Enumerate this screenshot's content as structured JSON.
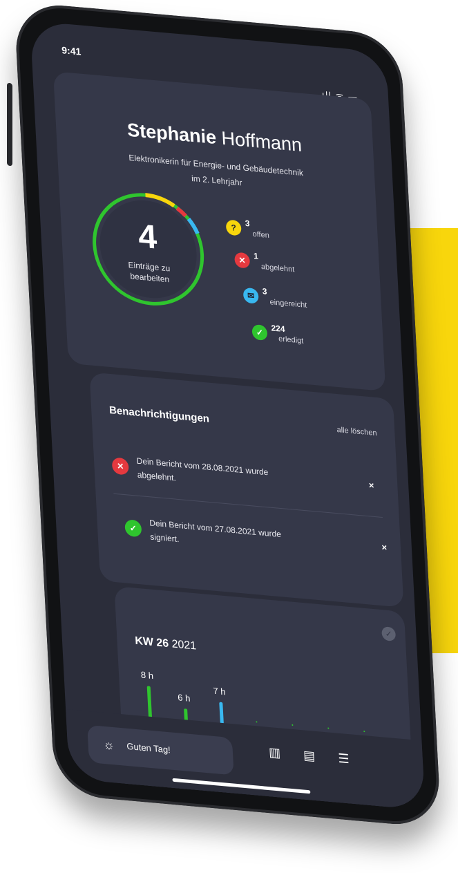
{
  "status_bar": {
    "time": "9:41",
    "icons": "ıll ᯤ ▬"
  },
  "profile": {
    "first_name": "Stephanie",
    "last_name": "Hoffmann",
    "role_line1": "Elektronikerin für Energie- und Gebäudetechnik",
    "role_line2": "im 2. Lehrjahr",
    "open_entries_count": "4",
    "open_entries_label_line1": "Einträge zu",
    "open_entries_label_line2": "bearbeiten",
    "stats": [
      {
        "icon": "?",
        "count": "3",
        "label": "offen",
        "color": "#f8d60c"
      },
      {
        "icon": "✕",
        "count": "1",
        "label": "abgelehnt",
        "color": "#e5393f"
      },
      {
        "icon": "✉",
        "count": "3",
        "label": "eingereicht",
        "color": "#39b8f0"
      },
      {
        "icon": "✓",
        "count": "224",
        "label": "erledigt",
        "color": "#2fc52e"
      }
    ]
  },
  "notifications": {
    "title": "Benachrichtigungen",
    "clear_label": "alle löschen",
    "items": [
      {
        "icon": "✕",
        "color": "#e5393f",
        "line1": "Dein Bericht vom 28.08.2021 wurde",
        "line2": "abgelehnt.",
        "close": "×"
      },
      {
        "icon": "✓",
        "color": "#2fc52e",
        "line1": "Dein Bericht vom 27.08.2021 wurde",
        "line2": "signiert.",
        "close": "×"
      }
    ]
  },
  "week": {
    "kw_label": "KW 26",
    "year": "2021",
    "check_icon": "✓"
  },
  "chart_data": {
    "type": "bar",
    "categories": [
      "",
      "",
      "",
      "",
      "",
      "",
      ""
    ],
    "values": [
      8,
      6,
      7,
      0,
      0,
      0,
      0
    ],
    "labels": [
      "8 h",
      "6 h",
      "7 h"
    ],
    "colors": [
      "#2fc52e",
      "#2fc52e",
      "#39b8f0",
      "#2fc52e",
      "#2fc52e",
      "#2fc52e",
      "#2fc52e"
    ],
    "ylim": [
      0,
      8
    ]
  },
  "bottom_nav": {
    "greeting": "Guten Tag!",
    "greeting_icon": "☼",
    "stats_icon": "▥",
    "report_icon": "▤",
    "menu_icon": "☰"
  },
  "colors": {
    "accent_yellow": "#f8d60c",
    "screen_bg": "#2b2d3a",
    "card_bg": "#353849"
  }
}
